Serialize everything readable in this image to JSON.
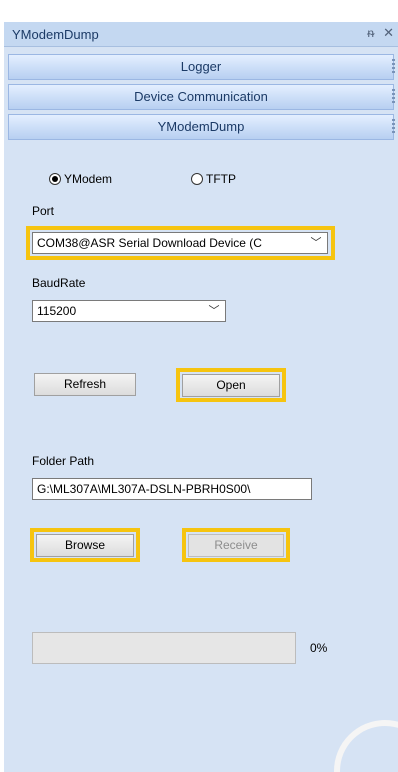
{
  "panel": {
    "title": "YModemDump",
    "pin_icon": "pin-icon",
    "close_icon": "close-icon"
  },
  "headers": [
    "Logger",
    "Device Communication",
    "YModemDump"
  ],
  "protocol": {
    "options": [
      "YModem",
      "TFTP"
    ],
    "selected": "YModem"
  },
  "port": {
    "label": "Port",
    "value": "COM38@ASR Serial Download Device (C"
  },
  "baudrate": {
    "label": "BaudRate",
    "value": "115200"
  },
  "buttons": {
    "refresh": "Refresh",
    "open": "Open",
    "browse": "Browse",
    "receive": "Receive"
  },
  "folder": {
    "label": "Folder Path",
    "value": "G:\\ML307A\\ML307A-DSLN-PBRH0S00\\"
  },
  "progress": {
    "percent_text": "0%",
    "value": 0
  },
  "colors": {
    "highlight": "#f6c40f",
    "panel_bg": "#d6e3f4",
    "header_text": "#1b3a66"
  }
}
